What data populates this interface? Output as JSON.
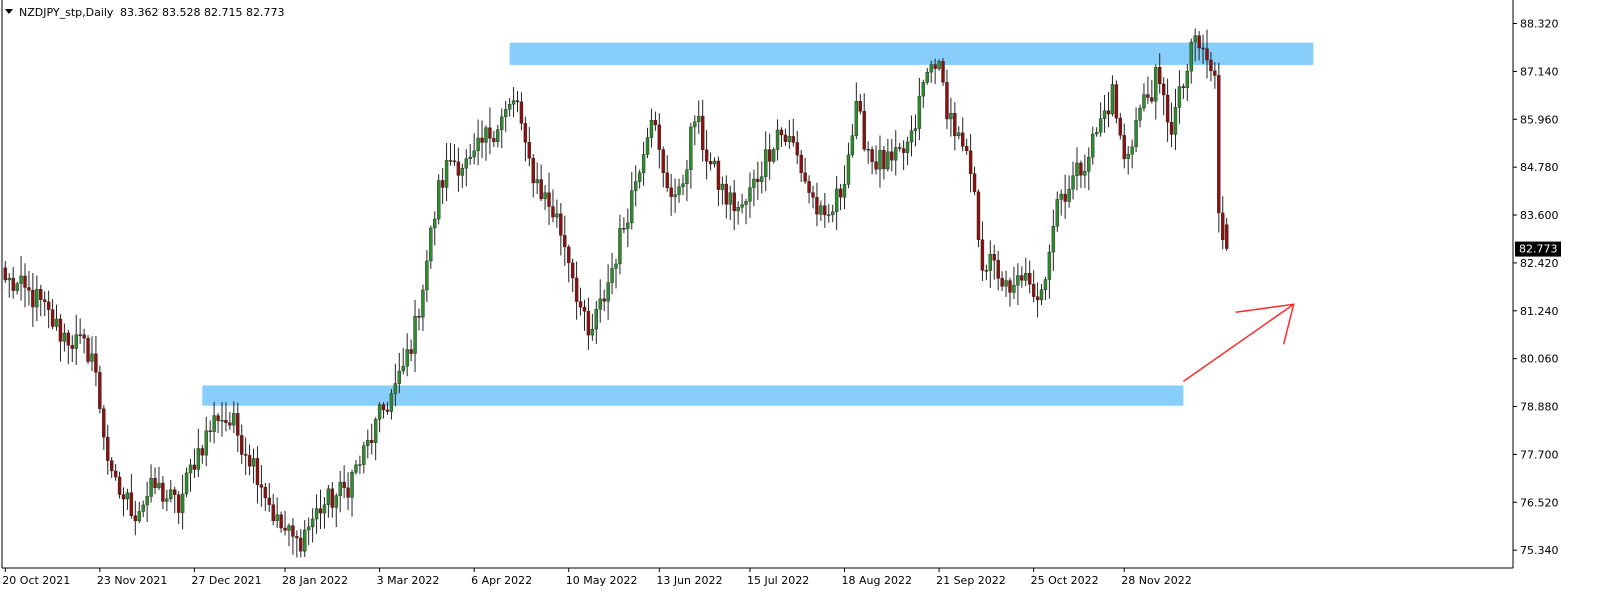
{
  "header": {
    "symbol": "NZDJPY_stp,Daily",
    "ohlc": "83.362 83.528 82.715 82.773"
  },
  "colors": {
    "bull": "#2e8b2e",
    "bear": "#8b1010",
    "wick": "#222222",
    "zone": "#87cefa",
    "arrow": "#ff2a2a",
    "axis": "#000000",
    "price_tag_bg": "#000000"
  },
  "chart_data": {
    "type": "candlestick",
    "symbol": "NZDJPY_stp",
    "timeframe": "Daily",
    "current_price": "82.773",
    "ylim": [
      74.9,
      88.9
    ],
    "y_ticks": [
      "88.320",
      "87.140",
      "85.960",
      "84.780",
      "83.600",
      "82.420",
      "81.240",
      "80.060",
      "78.880",
      "77.700",
      "76.520",
      "75.340"
    ],
    "x_ticks": [
      "20 Oct 2021",
      "23 Nov 2021",
      "27 Dec 2021",
      "28 Jan 2022",
      "3 Mar 2022",
      "6 Apr 2022",
      "10 May 2022",
      "13 Jun 2022",
      "15 Jul 2022",
      "18 Aug 2022",
      "21 Sep 2022",
      "25 Oct 2022",
      "28 Nov 2022"
    ],
    "zones": [
      {
        "from_bar": 128,
        "to_bar": 332,
        "low": 87.3,
        "high": 87.85
      },
      {
        "from_bar": 50,
        "to_bar": 299,
        "low": 78.9,
        "high": 79.4
      }
    ],
    "arrow": {
      "from": [
        299,
        79.5
      ],
      "to": [
        327,
        81.4
      ]
    },
    "close_points": [
      [
        0,
        82.0
      ],
      [
        8,
        81.5
      ],
      [
        14,
        80.7
      ],
      [
        22,
        80.2
      ],
      [
        27,
        77.0
      ],
      [
        33,
        76.3
      ],
      [
        38,
        76.9
      ],
      [
        44,
        76.4
      ],
      [
        48,
        77.6
      ],
      [
        54,
        78.7
      ],
      [
        58,
        78.4
      ],
      [
        64,
        77.3
      ],
      [
        69,
        76.0
      ],
      [
        74,
        75.5
      ],
      [
        80,
        76.4
      ],
      [
        86,
        76.8
      ],
      [
        91,
        77.7
      ],
      [
        96,
        78.8
      ],
      [
        100,
        79.5
      ],
      [
        104,
        80.8
      ],
      [
        107,
        82.5
      ],
      [
        110,
        84.2
      ],
      [
        113,
        85.0
      ],
      [
        118,
        84.8
      ],
      [
        122,
        85.5
      ],
      [
        126,
        86.0
      ],
      [
        130,
        86.4
      ],
      [
        132,
        85.1
      ],
      [
        136,
        84.2
      ],
      [
        140,
        83.5
      ],
      [
        143,
        82.6
      ],
      [
        146,
        81.3
      ],
      [
        148,
        80.5
      ],
      [
        152,
        81.6
      ],
      [
        156,
        83.0
      ],
      [
        160,
        84.5
      ],
      [
        164,
        86.2
      ],
      [
        167,
        84.5
      ],
      [
        171,
        84.0
      ],
      [
        175,
        86.0
      ],
      [
        179,
        84.8
      ],
      [
        183,
        84.0
      ],
      [
        187,
        83.7
      ],
      [
        192,
        84.8
      ],
      [
        196,
        85.7
      ],
      [
        200,
        85.3
      ],
      [
        204,
        84.2
      ],
      [
        208,
        83.3
      ],
      [
        212,
        84.2
      ],
      [
        216,
        86.1
      ],
      [
        220,
        85.0
      ],
      [
        225,
        84.8
      ],
      [
        230,
        85.4
      ],
      [
        233,
        86.8
      ],
      [
        236,
        87.5
      ],
      [
        239,
        86.3
      ],
      [
        242,
        85.4
      ],
      [
        245,
        84.6
      ],
      [
        248,
        82.5
      ],
      [
        252,
        82.2
      ],
      [
        255,
        81.5
      ],
      [
        258,
        82.2
      ],
      [
        261,
        81.4
      ],
      [
        264,
        82.3
      ],
      [
        267,
        84.0
      ],
      [
        272,
        84.6
      ],
      [
        276,
        85.4
      ],
      [
        281,
        86.6
      ],
      [
        284,
        84.9
      ],
      [
        288,
        86.2
      ],
      [
        292,
        86.9
      ],
      [
        296,
        85.8
      ],
      [
        299,
        86.8
      ],
      [
        302,
        87.9
      ],
      [
        305,
        87.4
      ],
      [
        307,
        86.9
      ],
      [
        308,
        83.5
      ],
      [
        310,
        82.773
      ]
    ]
  }
}
